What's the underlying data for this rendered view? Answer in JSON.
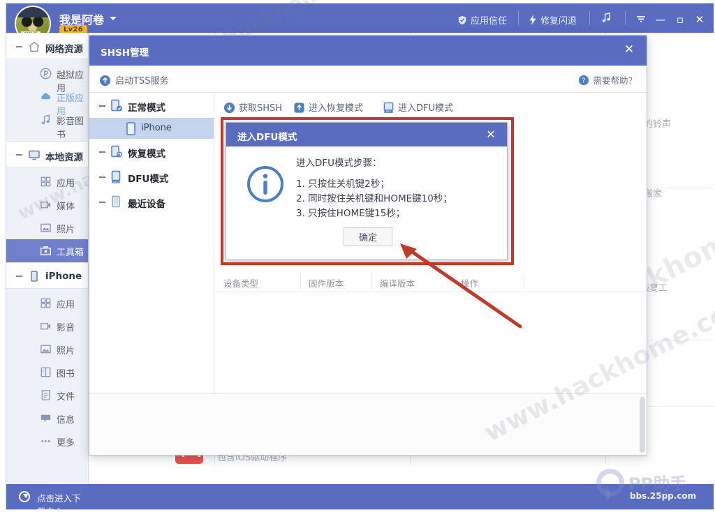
{
  "window": {
    "user_name": "我是阿卷",
    "level_badge": "Lv26",
    "avatar_tag": "PP助手",
    "toolbar": [
      {
        "label": "应用信任",
        "icon": "shield-check-icon"
      },
      {
        "label": "修复闪退",
        "icon": "lightning-icon"
      },
      {
        "label": "",
        "icon": "music-note-icon"
      }
    ],
    "controls": {
      "more": "▼",
      "minimize": "—",
      "maximize": "▫",
      "close": "✕"
    }
  },
  "sidebar": {
    "groups": [
      {
        "label": "网络资源",
        "icon": "home-icon",
        "items": [
          {
            "label": "越狱应用",
            "icon": "pp-icon",
            "state": "normal"
          },
          {
            "label": "正版应用",
            "icon": "cloud-icon",
            "state": "link"
          },
          {
            "label": "影音图书",
            "icon": "music-icon",
            "state": "normal"
          }
        ]
      },
      {
        "label": "本地资源",
        "icon": "monitor-icon",
        "items": [
          {
            "label": "应用",
            "icon": "apps-grid-icon",
            "state": "normal"
          },
          {
            "label": "媒体",
            "icon": "video-icon",
            "state": "normal"
          },
          {
            "label": "照片",
            "icon": "photo-icon",
            "state": "normal"
          },
          {
            "label": "工具箱",
            "icon": "toolbox-icon",
            "state": "active"
          }
        ]
      },
      {
        "label": "iPhone",
        "icon": "phone-icon",
        "items": [
          {
            "label": "应用",
            "icon": "apps-grid-icon",
            "state": "normal"
          },
          {
            "label": "影音",
            "icon": "video-icon",
            "state": "normal"
          },
          {
            "label": "照片",
            "icon": "photo-icon",
            "state": "normal"
          },
          {
            "label": "图书",
            "icon": "book-icon",
            "state": "normal"
          },
          {
            "label": "文件",
            "icon": "file-icon",
            "state": "normal"
          },
          {
            "label": "信息",
            "icon": "message-icon",
            "state": "normal"
          },
          {
            "label": "更多",
            "icon": "ellipsis-icon",
            "state": "normal"
          }
        ]
      }
    ],
    "download_center": "点击进入下载中心"
  },
  "background": {
    "fragments": [
      "持的铃声",
      "松搬家",
      "恢复工"
    ],
    "driver_note": "包含iOS驱动程序"
  },
  "shsh_window": {
    "title": "SHSH管理",
    "close": "✕",
    "tss_service": "启动TSS服务",
    "help": "需要帮助？",
    "modes": [
      {
        "label": "正常模式",
        "icon": "normal-mode-icon",
        "device": "iPhone",
        "device_icon": "iphone-icon"
      },
      {
        "label": "恢复模式",
        "icon": "recovery-mode-icon"
      },
      {
        "label": "DFU模式",
        "icon": "dfu-mode-icon"
      },
      {
        "label": "最近设备",
        "icon": "recent-device-icon"
      }
    ],
    "actions": [
      {
        "label": "获取SHSH",
        "icon": "download-icon"
      },
      {
        "label": "进入恢复模式",
        "icon": "recovery-icon"
      },
      {
        "label": "进入DFU模式",
        "icon": "dfu-icon"
      }
    ],
    "table_headers": [
      "设备类型",
      "固件版本",
      "编译版本",
      "操作"
    ]
  },
  "dfu_dialog": {
    "title": "进入DFU模式",
    "close": "✕",
    "heading": "进入DFU模式步骤：",
    "steps": [
      "1. 只按住关机键2秒；",
      "2. 同时按住关机键和HOME键10秒；",
      "3. 只按住HOME键15秒；"
    ],
    "ok_label": "确定",
    "info_icon": "info-circle-icon"
  },
  "branding": {
    "pp_name": "PP助手",
    "pp_url": "bbs.25pp.com",
    "watermark": "www.hackhome.com"
  },
  "colors": {
    "accent": "#5a6cc0",
    "sidebar_active": "#7180ca",
    "highlight_box": "#c0392b",
    "device_row": "#c5d4ee",
    "badge": "#f2b32c"
  }
}
